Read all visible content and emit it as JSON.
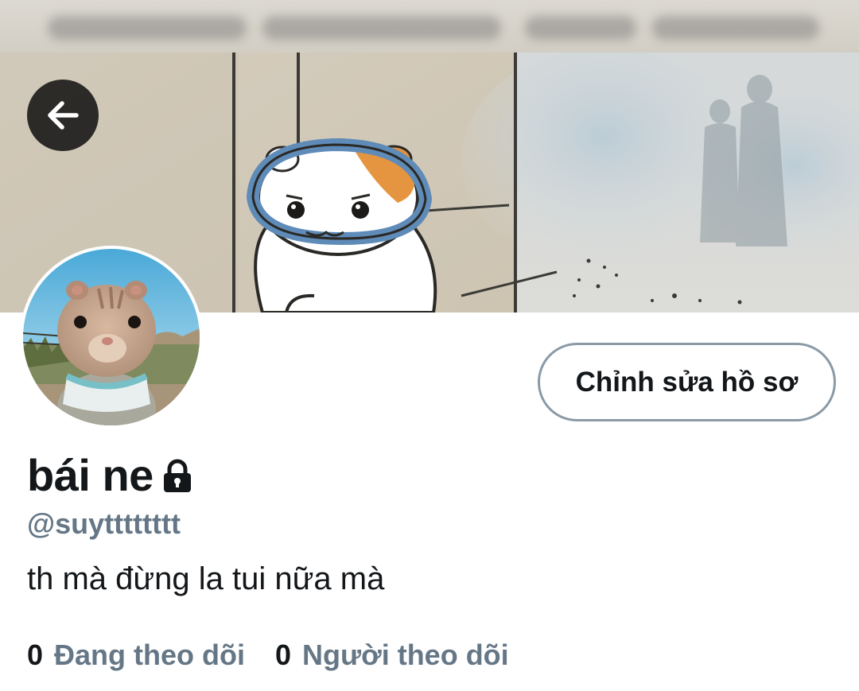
{
  "header": {
    "back_icon": "arrow-left-icon"
  },
  "profile": {
    "display_name": "bái ne",
    "protected_icon": "lock-icon",
    "handle": "@suytttttttt",
    "bio": "th mà đừng la tui nữa mà",
    "edit_button_label": "Chỉnh sửa hồ sơ",
    "stats": [
      {
        "count": "0",
        "label": "Đang theo dõi"
      },
      {
        "count": "0",
        "label": "Người theo dõi"
      }
    ]
  },
  "colors": {
    "primary_text": "#14171a",
    "secondary_text": "#657786",
    "button_border": "#8a9aa6",
    "back_button_bg": "#141414"
  }
}
